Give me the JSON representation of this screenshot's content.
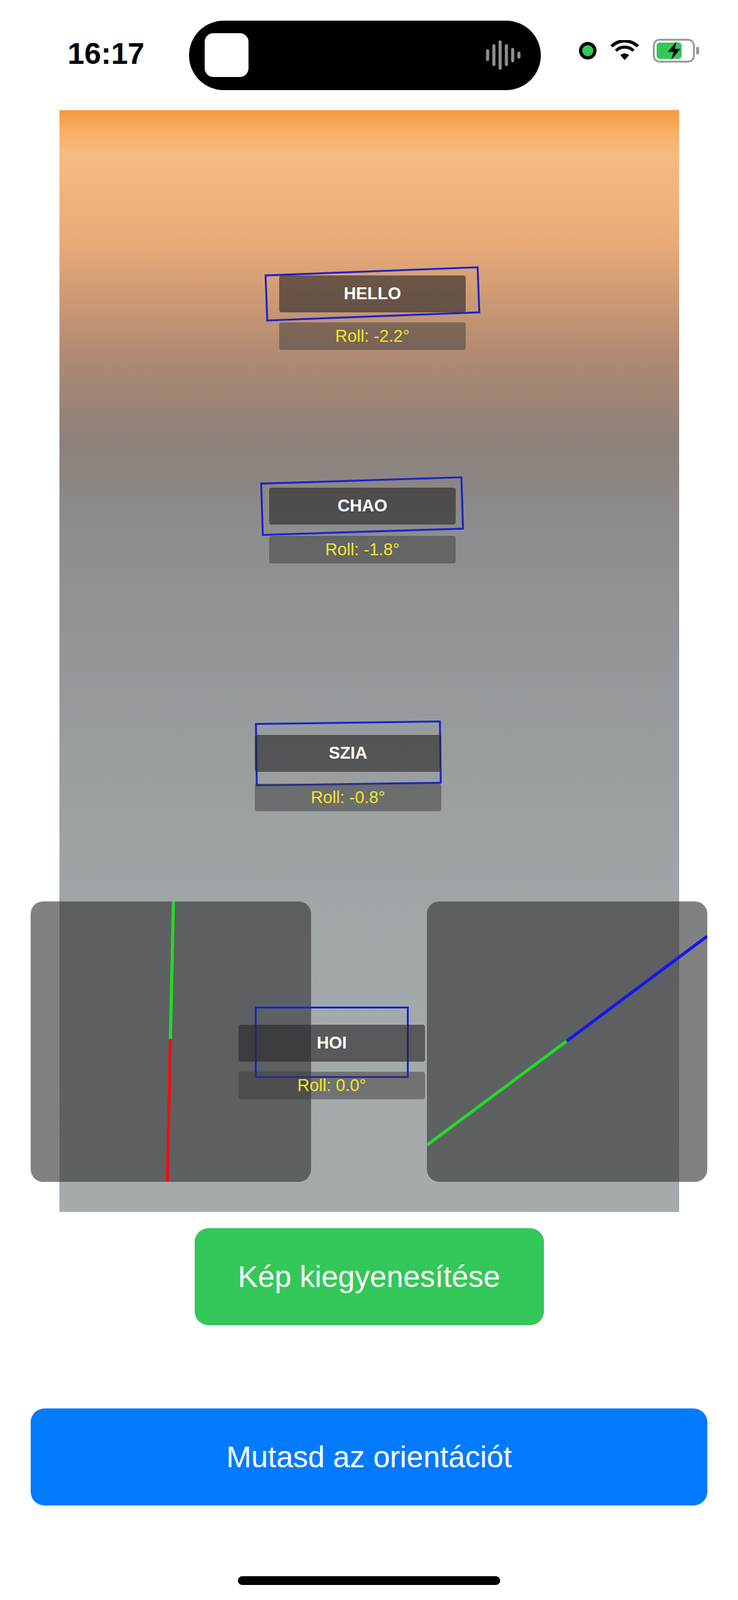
{
  "status_bar": {
    "time": "16:17"
  },
  "detections": [
    {
      "label": "HELLO",
      "roll": "Roll: -2.2°",
      "angle": -2.2
    },
    {
      "label": "CHAO",
      "roll": "Roll: -1.8°",
      "angle": -1.8
    },
    {
      "label": "SZIA",
      "roll": "Roll: -0.8°",
      "angle": -0.8
    },
    {
      "label": "HOI",
      "roll": "Roll: 0.0°",
      "angle": 0.0
    }
  ],
  "orientation_panels": [
    {
      "kind": "vertical"
    },
    {
      "kind": "horizon"
    }
  ],
  "buttons": [
    "Kép kiegyenesítése",
    "Mutasd az orientációt"
  ]
}
